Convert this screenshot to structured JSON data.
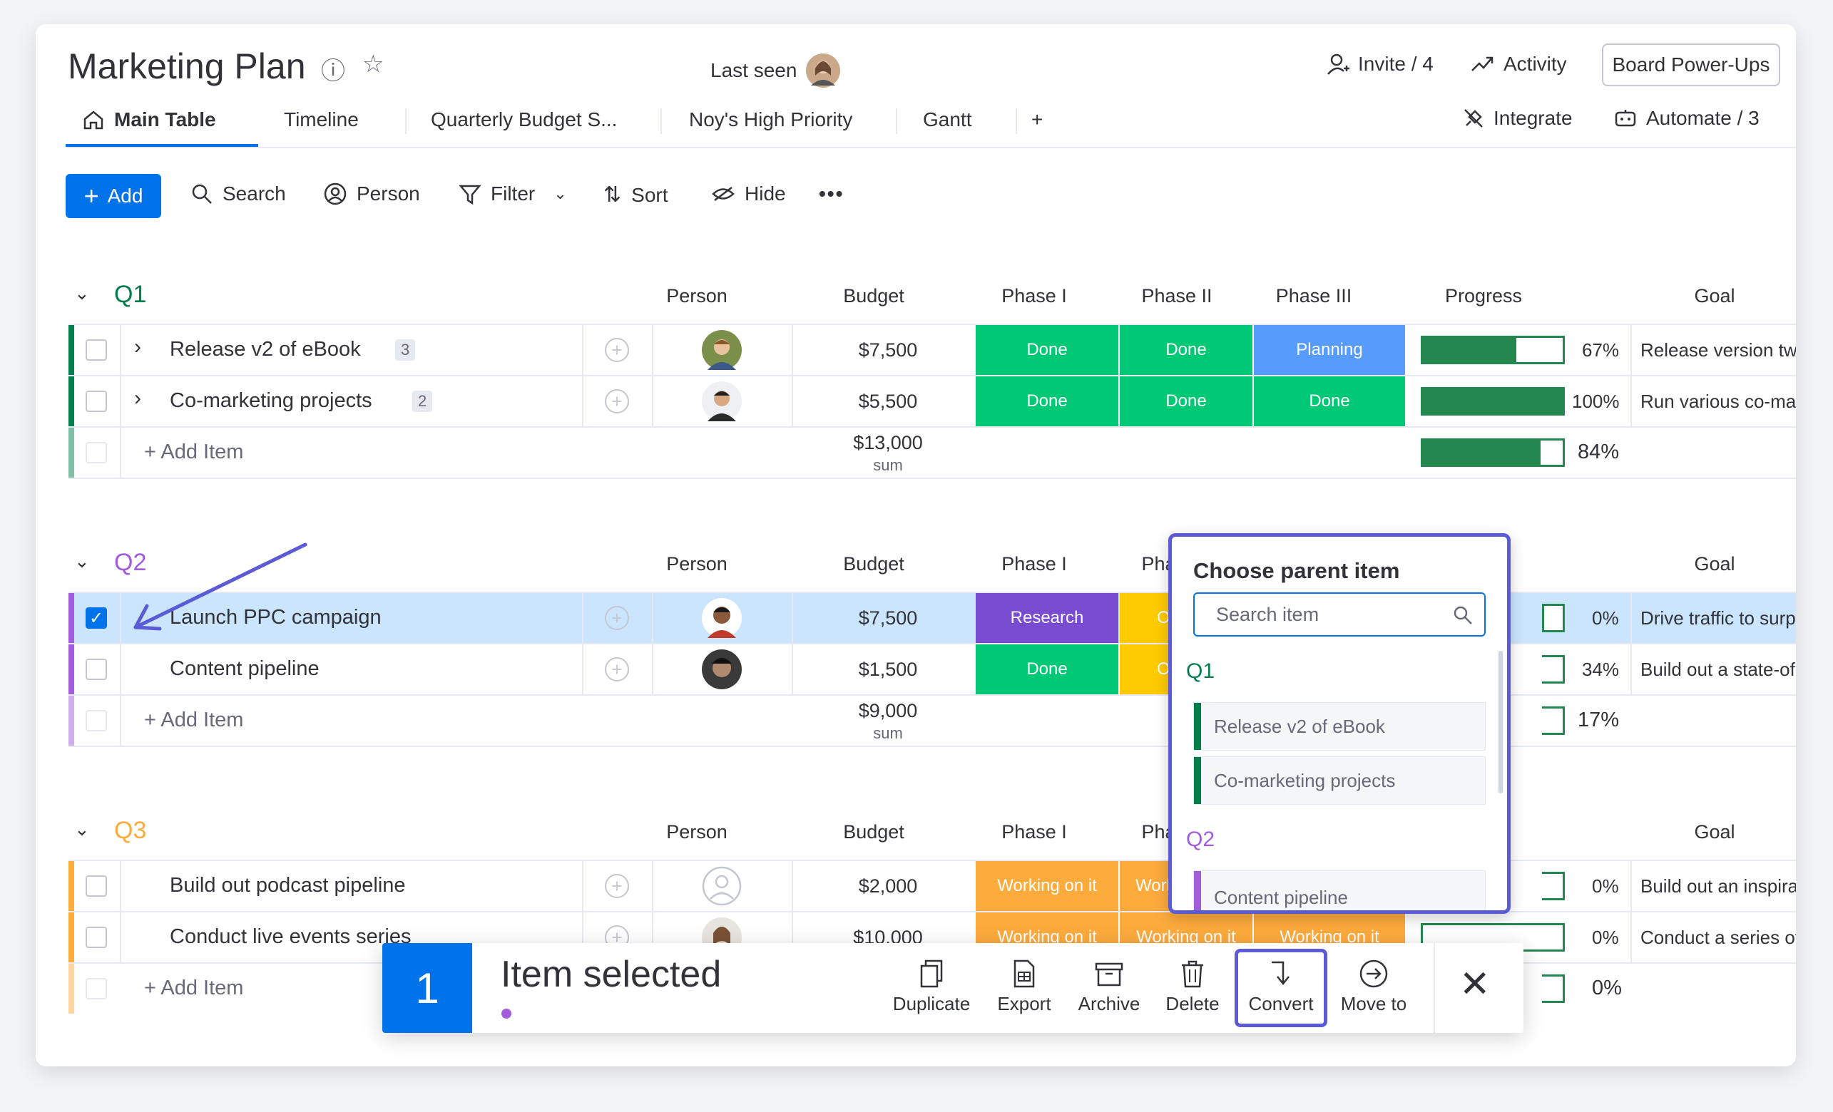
{
  "header": {
    "title": "Marketing Plan",
    "last_seen_label": "Last seen",
    "invite_label": "Invite / 4",
    "activity_label": "Activity",
    "power_ups_label": "Board Power-Ups",
    "integrate_label": "Integrate",
    "automate_label": "Automate / 3"
  },
  "tabs": [
    {
      "label": "Main Table",
      "active": true
    },
    {
      "label": "Timeline"
    },
    {
      "label": "Quarterly Budget S..."
    },
    {
      "label": "Noy's High Priority"
    },
    {
      "label": "Gantt"
    },
    {
      "label": "+"
    }
  ],
  "toolbar": {
    "add_label": "Add",
    "search_label": "Search",
    "person_label": "Person",
    "filter_label": "Filter",
    "sort_label": "Sort",
    "hide_label": "Hide",
    "more_label": "•••"
  },
  "columns": {
    "person": "Person",
    "budget": "Budget",
    "phase1": "Phase I",
    "phase2": "Phase II",
    "phase3": "Phase III",
    "progress": "Progress",
    "goal": "Goal"
  },
  "groups": [
    {
      "name": "Q1",
      "color": "#037f4c",
      "rows": [
        {
          "name": "Release v2 of eBook",
          "subitems": "3",
          "budget": "$7,500",
          "phase1": "Done",
          "phase2": "Done",
          "phase3": "Planning",
          "progress_pct": "67%",
          "progress": 0.67,
          "goal": "Release version two of"
        },
        {
          "name": "Co-marketing projects",
          "subitems": "2",
          "budget": "$5,500",
          "phase1": "Done",
          "phase2": "Done",
          "phase3": "Done",
          "progress_pct": "100%",
          "progress": 1.0,
          "goal": "Run various co-marketi"
        }
      ],
      "add_item": "+ Add Item",
      "sum_value": "$13,000",
      "sum_label": "sum",
      "sum_progress_pct": "84%",
      "sum_progress": 0.84
    },
    {
      "name": "Q2",
      "color": "#a25ddc",
      "rows": [
        {
          "name": "Launch PPC campaign",
          "budget": "$7,500",
          "phase1": "Research",
          "phase2": "On-ho",
          "progress_pct": "0%",
          "progress": 0.0,
          "goal": "Drive traffic to surpass"
        },
        {
          "name": "Content pipeline",
          "budget": "$1,500",
          "phase1": "Done",
          "phase2": "On-ho",
          "progress_pct": "34%",
          "progress": 0.34,
          "goal": "Build out a state-of-the"
        }
      ],
      "add_item": "+ Add Item",
      "sum_value": "$9,000",
      "sum_label": "sum",
      "sum_progress_pct": "17%"
    },
    {
      "name": "Q3",
      "color": "#fdab3d",
      "rows": [
        {
          "name": "Build out podcast pipeline",
          "budget": "$2,000",
          "phase1": "Working on it",
          "phase2": "Working",
          "progress_pct": "0%",
          "goal": "Build out an inspiration"
        },
        {
          "name": "Conduct live events series",
          "budget": "$10,000",
          "phase1": "Working on it",
          "phase2": "Working on it",
          "phase3": "Working on it",
          "progress_pct": "0%",
          "goal": "Conduct a series of live"
        }
      ],
      "add_item": "+ Add Item",
      "sum_progress_pct": "0%"
    }
  ],
  "status_colors": {
    "done": "#00c875",
    "planning": "#579bfc",
    "research": "#784bd1",
    "on_hold": "#ffcb00",
    "working": "#fdab3d"
  },
  "popup": {
    "title": "Choose parent item",
    "search_placeholder": "Search item",
    "groups": [
      {
        "name": "Q1",
        "items": [
          "Release v2 of eBook",
          "Co-marketing projects"
        ]
      },
      {
        "name": "Q2",
        "items": [
          "Content pipeline"
        ]
      }
    ]
  },
  "action_bar": {
    "count": "1",
    "label": "Item selected",
    "actions": [
      "Duplicate",
      "Export",
      "Archive",
      "Delete",
      "Convert",
      "Move to"
    ],
    "close": "✕"
  }
}
